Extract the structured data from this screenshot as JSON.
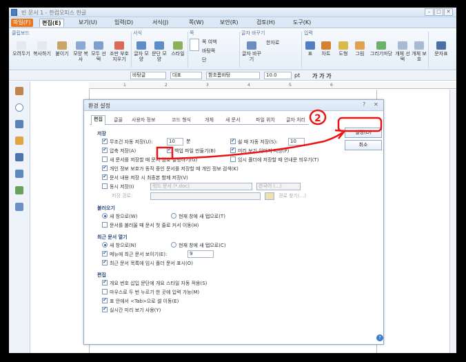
{
  "window": {
    "title": "빈 문서 1 - 한컴오피스 한글"
  },
  "menubar": {
    "file": "파일(F)",
    "items": [
      "편집(E)",
      "보기(U)",
      "입력(D)",
      "서식(J)",
      "쪽(W)",
      "보안(R)",
      "검토(H)",
      "도구(K)"
    ]
  },
  "ribbon": {
    "groups": [
      "클립보드",
      "서식",
      "쪽",
      "글자 바꾸기",
      "입력"
    ],
    "buttons": [
      "오려두기",
      "복사하기",
      "붙이기",
      "모양 복사",
      "모두 선택",
      "조판 부호 지우기",
      "글자 모양",
      "문단 모양",
      "스타일",
      "쪽 여백",
      "바탕쪽",
      "단",
      "글자 바꾸기",
      "한자로",
      "표",
      "차트",
      "도형",
      "그림",
      "그리기마당",
      "개체 선택",
      "개체 보호",
      "문자표"
    ]
  },
  "format_bar": {
    "style": "바탕글",
    "language": "대표",
    "font": "함초롬바탕",
    "size": "10.0",
    "unit": "pt",
    "styles": "가 가 가"
  },
  "ruler": {
    "ticks": [
      "1",
      "2",
      "3",
      "4",
      "5",
      "6"
    ]
  },
  "dialog": {
    "title": "환경 설정",
    "tabs": [
      "편집",
      "글꼴",
      "사용자 정보",
      "코드 형식",
      "개체",
      "새 문서",
      "파일 위치",
      "글자 처리"
    ],
    "save": {
      "heading": "저장",
      "autosave_label": "무조건 자동 저장(U):",
      "autosave_value": "10",
      "autosave_unit": "분",
      "idle_save_label": "쉴 때 자동 저장(S):",
      "idle_save_value": "10",
      "compress_label": "압축 저장(A)",
      "backup_label": "백업 파일 만들기(B)",
      "preview_label": "미리 보기 이미지 저장(P)",
      "encrypt_label": "새 문서를 저장할 때 문서 암호 설정하기(G)",
      "temp_folder_label": "임시 폴더에 저장할 때 안내문 띄우기(T)",
      "personal_info_label": "개인 정보 보호가 동작 중인 문서를 저장할 때 개인 정보 검색(K)",
      "last_position_label": "문서 내용 저장 시 최종본 함께 저장(V)",
      "sync_label": "동시 저장(I)",
      "sync_format": "워드 문서 (*.doc)",
      "sync_encoding": "한국어 (...)",
      "sync_path_label": "저장 경로:",
      "browse_label": "경로 찾기(...)"
    },
    "open": {
      "heading": "불러오기",
      "new_window": "새 창으로(W)",
      "new_tab": "현재 창에 새 탭으로(T)",
      "first_page": "문서를 불러올 때 문서 첫 줄로 커서 이동(H)"
    },
    "recent": {
      "heading": "최근 문서 열기",
      "new_window": "새 창으로(N)",
      "new_tab": "현재 창에 새 탭으로(C)",
      "show_menu_label": "메뉴에 최근 문서 보이기(E):",
      "show_menu_value": "9",
      "show_temp_label": "최근 문서 목록에 임시 폴더 문서 표시(O)"
    },
    "edit": {
      "heading": "편집",
      "outline_style": "개요 번호 삽입 문단에 개요 스타일 자동 적용(S)",
      "double_click": "마우스로 두 번 누르기 한 곳에 입력 가능(M)",
      "tab_move": "표 안에서 <Tab>으로 셀 이동(E)",
      "realtime_preview": "실시간 미리 보기 사용(Y)"
    },
    "buttons": {
      "ok": "설정(D)",
      "cancel": "취소"
    }
  },
  "annotation": {
    "step": "2",
    "color": "#ee1111"
  }
}
